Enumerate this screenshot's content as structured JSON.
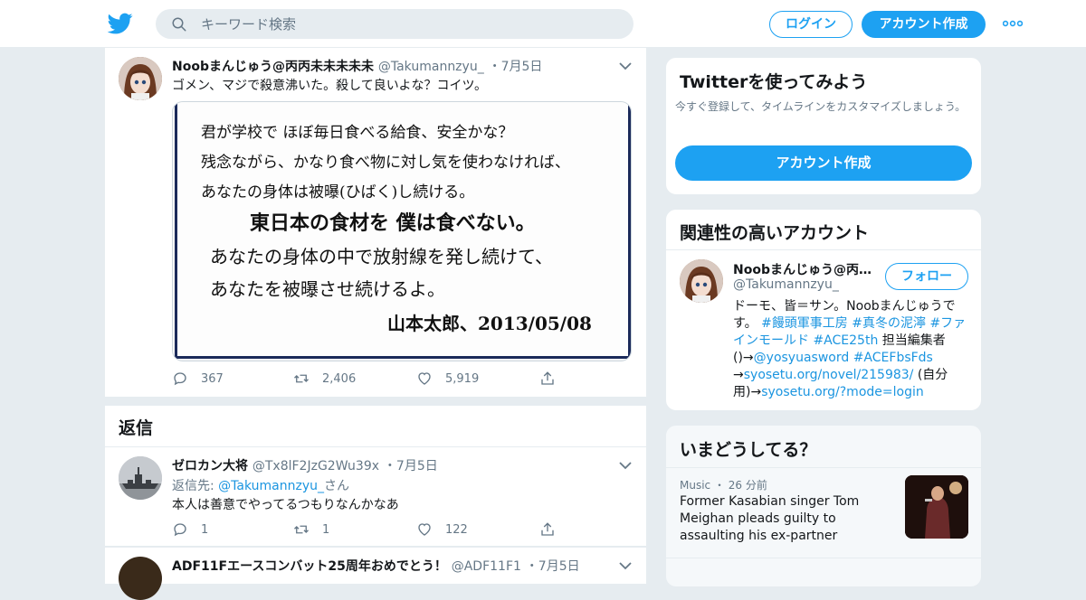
{
  "header": {
    "search_placeholder": "キーワード検索",
    "login_label": "ログイン",
    "signup_label": "アカウント作成"
  },
  "tweet": {
    "display_name": "Noobまんじゅう@丙丙未未未未未",
    "handle": "@Takumannzyu_",
    "date": "7月5日",
    "text": "ゴメン、マジで殺意沸いた。殺して良いよな？コイツ。",
    "media_lines": [
      "君が学校で ほぼ毎日食べる給食、安全かな？",
      "残念ながら、かなり食べ物に対し気を使わなければ、",
      "あなたの身体は被曝(ひばく)し続ける。",
      "東日本の食材を 僕は食べない。",
      "あなたの身体の中で放射線を発し続けて、",
      "あなたを被曝させ続けるよ。",
      "山本太郎、2013/05/08"
    ],
    "replies": "367",
    "retweets": "2,406",
    "likes": "5,919"
  },
  "replies_section": {
    "title": "返信"
  },
  "reply1": {
    "display_name": "ゼロカン大将",
    "handle": "@Tx8lF2JzG2Wu39x",
    "date": "7月5日",
    "reply_to_prefix": "返信先: ",
    "reply_to_handle": "@Takumannzyu_",
    "reply_to_suffix": "さん",
    "text": "本人は善意でやってるつもりなんかなあ",
    "replies": "1",
    "retweets": "1",
    "likes": "122"
  },
  "reply2": {
    "display_name": "ADF11Fエースコンバット25周年おめでとう！",
    "handle": "@ADF11F1",
    "date": "7月5日"
  },
  "sidebar": {
    "try_title": "Twitterを使ってみよう",
    "try_sub": "今すぐ登録して、タイムラインをカスタマイズしましょう。",
    "try_button": "アカウント作成",
    "related_title": "関連性の高いアカウント",
    "account_name": "Noobまんじゅう@丙丙未未未未未",
    "account_handle": "@Takumannzyu_",
    "follow_label": "フォロー",
    "bio_1": "ドーモ、皆＝サン。Noobまんじゅうです。 ",
    "bio_tag1": "#饅頭軍事工房",
    "bio_tag2": "#真冬の泥濘",
    "bio_tag3": "#ファインモールド",
    "bio_tag4": "#ACE25th",
    "bio_2": " 担当編集者()→",
    "bio_link1": "@yosyuasword",
    "bio_tag5": "#ACEFbsFds",
    "bio_3": "→",
    "bio_link2": "syosetu.org/novel/215983/",
    "bio_4": " (自分用)→",
    "bio_link3": "syosetu.org/?mode=login",
    "trends_title": "いまどうしてる？",
    "trend_category": "Music",
    "trend_time": "26 分前",
    "trend_text": "Former Kasabian singer Tom Meighan pleads guilty to assaulting his ex-partner"
  },
  "colors": {
    "brand": "#1da1f2",
    "link": "#1b95e0",
    "muted": "#657786",
    "background": "#e6ecf0"
  }
}
